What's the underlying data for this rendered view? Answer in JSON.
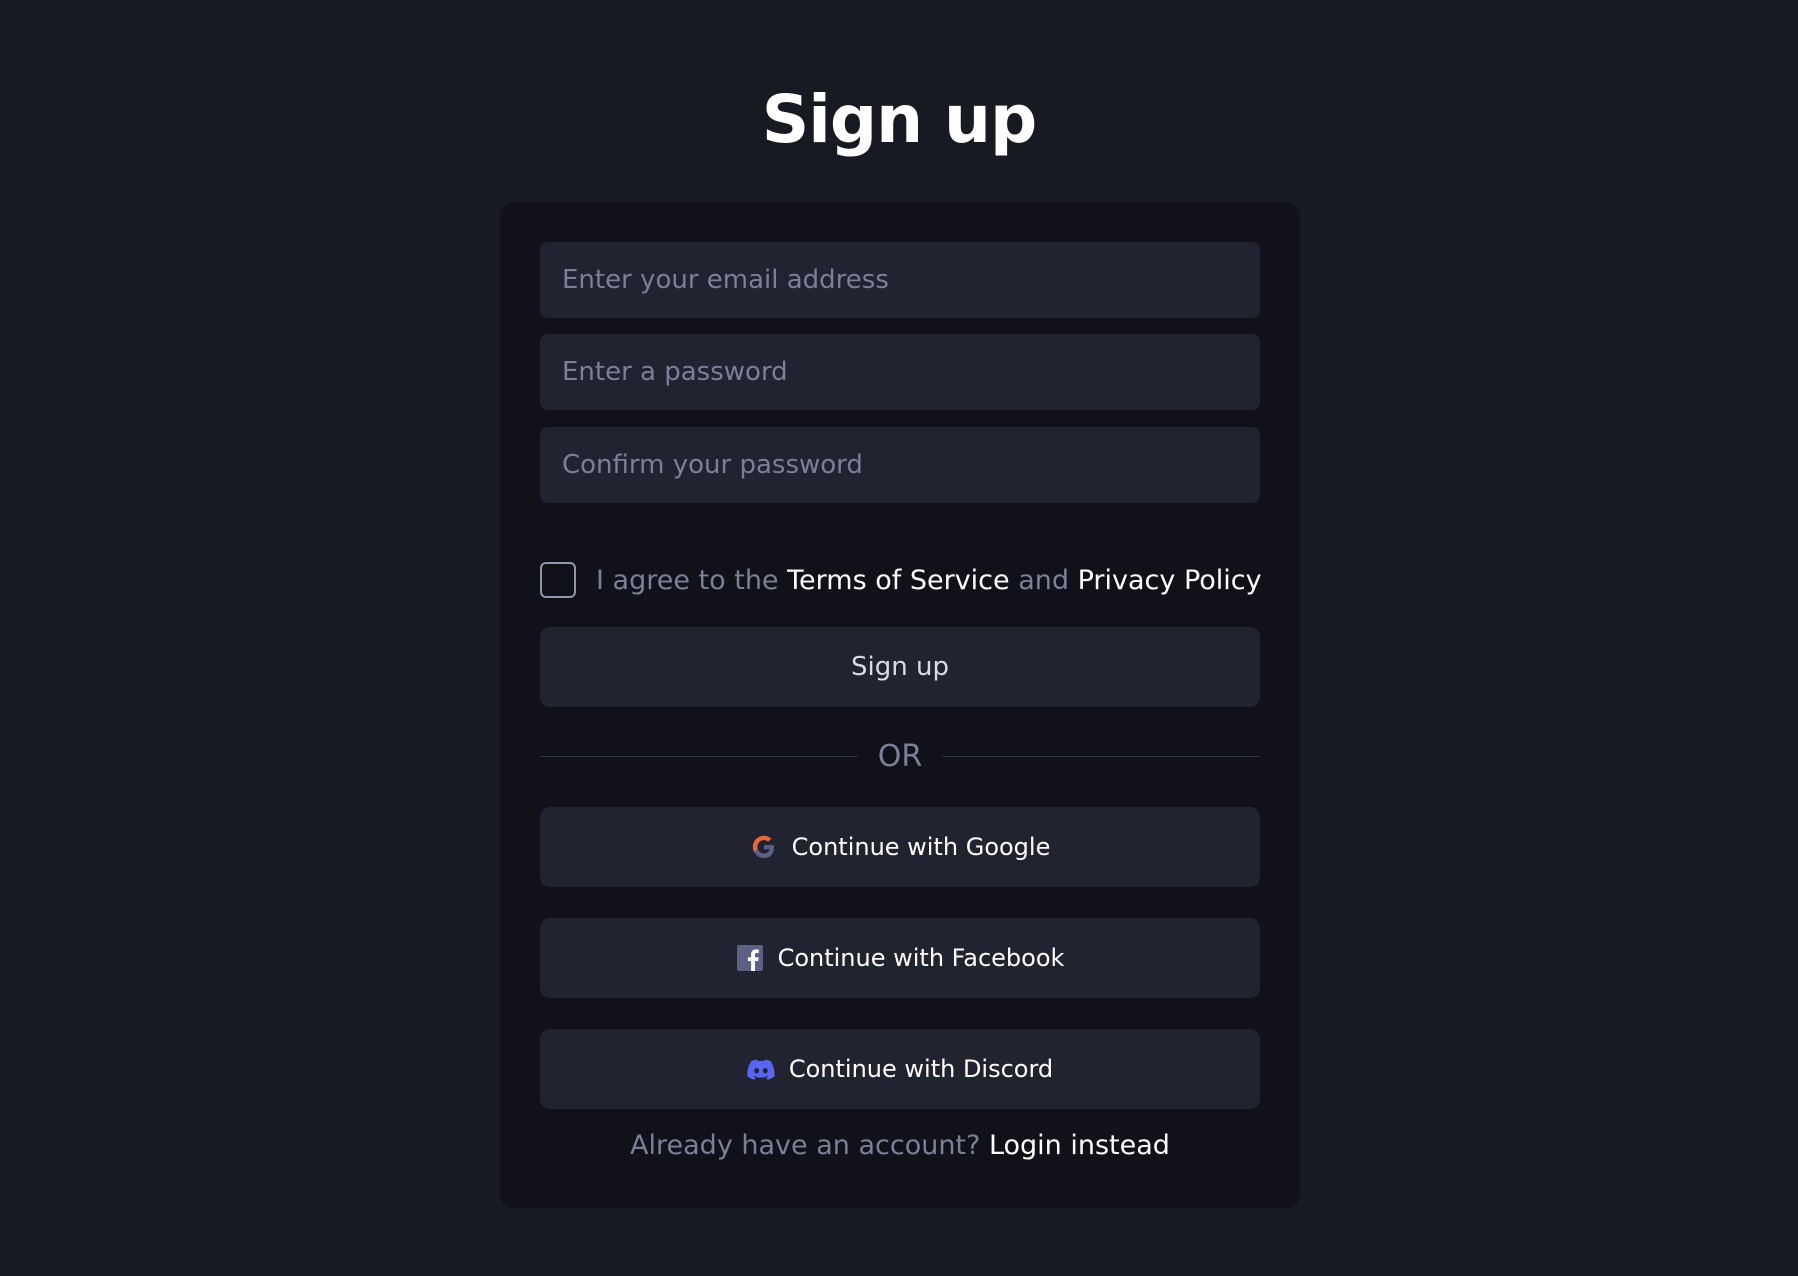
{
  "page": {
    "title": "Sign up"
  },
  "form": {
    "email": {
      "value": "",
      "placeholder": "Enter your email address"
    },
    "password": {
      "value": "",
      "placeholder": "Enter a password"
    },
    "confirm_password": {
      "value": "",
      "placeholder": "Confirm your password"
    },
    "agree": {
      "checked": false,
      "prefix": "I agree to the",
      "terms_link": "Terms of Service",
      "conjunction": "and",
      "privacy_link": "Privacy Policy"
    },
    "submit_label": "Sign up"
  },
  "divider": {
    "label": "OR"
  },
  "social": {
    "google": {
      "label": "Continue with Google",
      "icon": "google-icon"
    },
    "facebook": {
      "label": "Continue with Facebook",
      "icon": "facebook-icon"
    },
    "discord": {
      "label": "Continue with Discord",
      "icon": "discord-icon"
    }
  },
  "footer": {
    "prompt": "Already have an account?",
    "login_link": "Login instead"
  },
  "colors": {
    "background": "#171923",
    "card": "#111219",
    "input": "#212331",
    "muted_text": "#7b7f97",
    "discord_brand": "#5865f2",
    "google_orange": "#e8663a",
    "facebook_square": "#5b6085"
  }
}
